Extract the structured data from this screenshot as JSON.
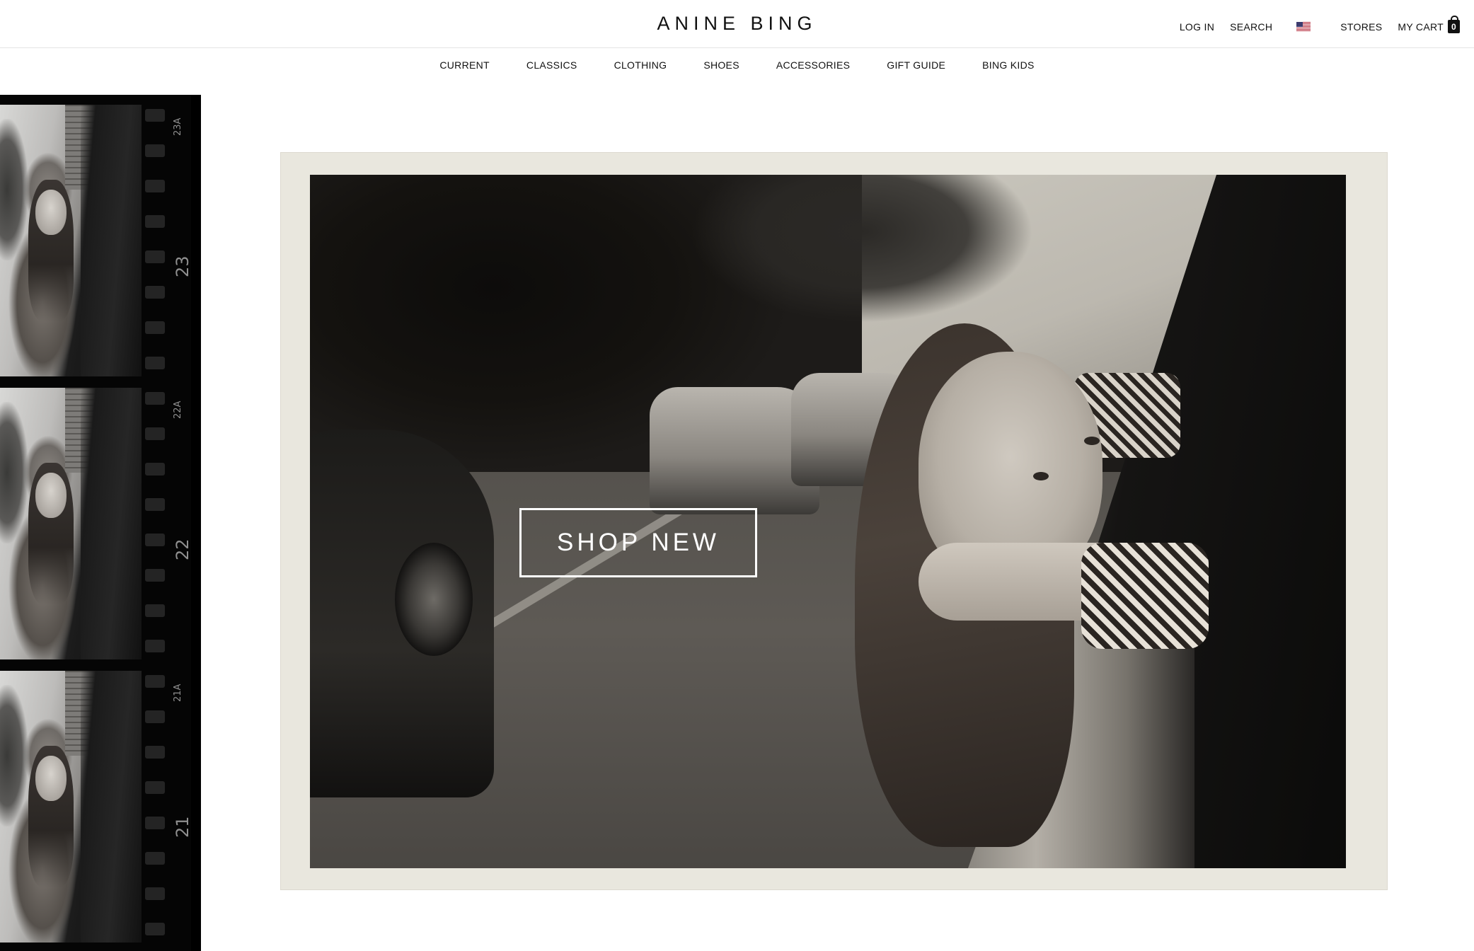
{
  "header": {
    "logo": "ANINE BING",
    "login": "LOG IN",
    "search": "SEARCH",
    "flag_icon": "us-flag-icon",
    "stores": "STORES",
    "cart_label": "MY CART",
    "cart_count": "0"
  },
  "nav": {
    "items": [
      "CURRENT",
      "CLASSICS",
      "CLOTHING",
      "SHOES",
      "ACCESSORIES",
      "GIFT GUIDE",
      "BING KIDS"
    ]
  },
  "film_strip": {
    "edge_numbers": [
      "23A",
      "23",
      "22A",
      "22",
      "21A",
      "21"
    ]
  },
  "hero": {
    "cta": "SHOP NEW"
  }
}
